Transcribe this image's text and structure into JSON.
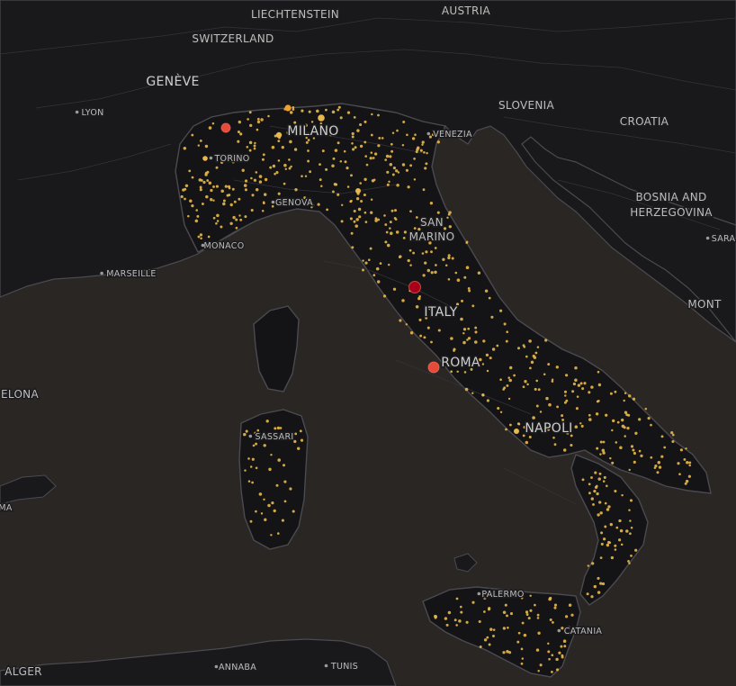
{
  "map": {
    "theme": "dark",
    "colors": {
      "water": "#2a2624",
      "land": "#19191b",
      "italy_land": "#141416",
      "border": "#3c3c44",
      "coast": "#4a4a50",
      "point_small": "#e8b84a",
      "point_medium": "#f0a030",
      "point_large": "#e84a3a",
      "point_max": "#a80018"
    },
    "country_labels": [
      {
        "id": "liechtenstein",
        "text": "LIECHTENSTEIN"
      },
      {
        "id": "austria",
        "text": "AUSTRIA"
      },
      {
        "id": "switzerland",
        "text": "SWITZERLAND"
      },
      {
        "id": "slovenia",
        "text": "SLOVENIA"
      },
      {
        "id": "croatia",
        "text": "CROATIA"
      },
      {
        "id": "bosnia-1",
        "text": "BOSNIA AND"
      },
      {
        "id": "bosnia-2",
        "text": "HERZEGOVINA"
      },
      {
        "id": "san-marino-1",
        "text": "SAN"
      },
      {
        "id": "san-marino-2",
        "text": "MARINO"
      },
      {
        "id": "italy",
        "text": "ITALY"
      },
      {
        "id": "monte",
        "text": "MONT"
      }
    ],
    "city_labels": [
      {
        "id": "geneve",
        "text": "GENÈVE"
      },
      {
        "id": "lyon",
        "text": "LYON"
      },
      {
        "id": "milano",
        "text": "MILANO"
      },
      {
        "id": "torino",
        "text": "TORINO"
      },
      {
        "id": "venezia",
        "text": "VENEZIA"
      },
      {
        "id": "genova",
        "text": "GENOVA"
      },
      {
        "id": "monaco",
        "text": "MONACO"
      },
      {
        "id": "marseille",
        "text": "MARSEILLE"
      },
      {
        "id": "barcelona",
        "text": "ELONA"
      },
      {
        "id": "roma",
        "text": "ROMA"
      },
      {
        "id": "napoli",
        "text": "NAPOLI"
      },
      {
        "id": "sassari",
        "text": "SASSARI"
      },
      {
        "id": "palermo",
        "text": "PALERMO"
      },
      {
        "id": "catania",
        "text": "CATANIA"
      },
      {
        "id": "alger",
        "text": "ALGER"
      },
      {
        "id": "annaba",
        "text": "ANNABA"
      },
      {
        "id": "tunis",
        "text": "TUNIS"
      },
      {
        "id": "sara",
        "text": "SARA"
      },
      {
        "id": "ma",
        "text": "MA"
      }
    ]
  }
}
